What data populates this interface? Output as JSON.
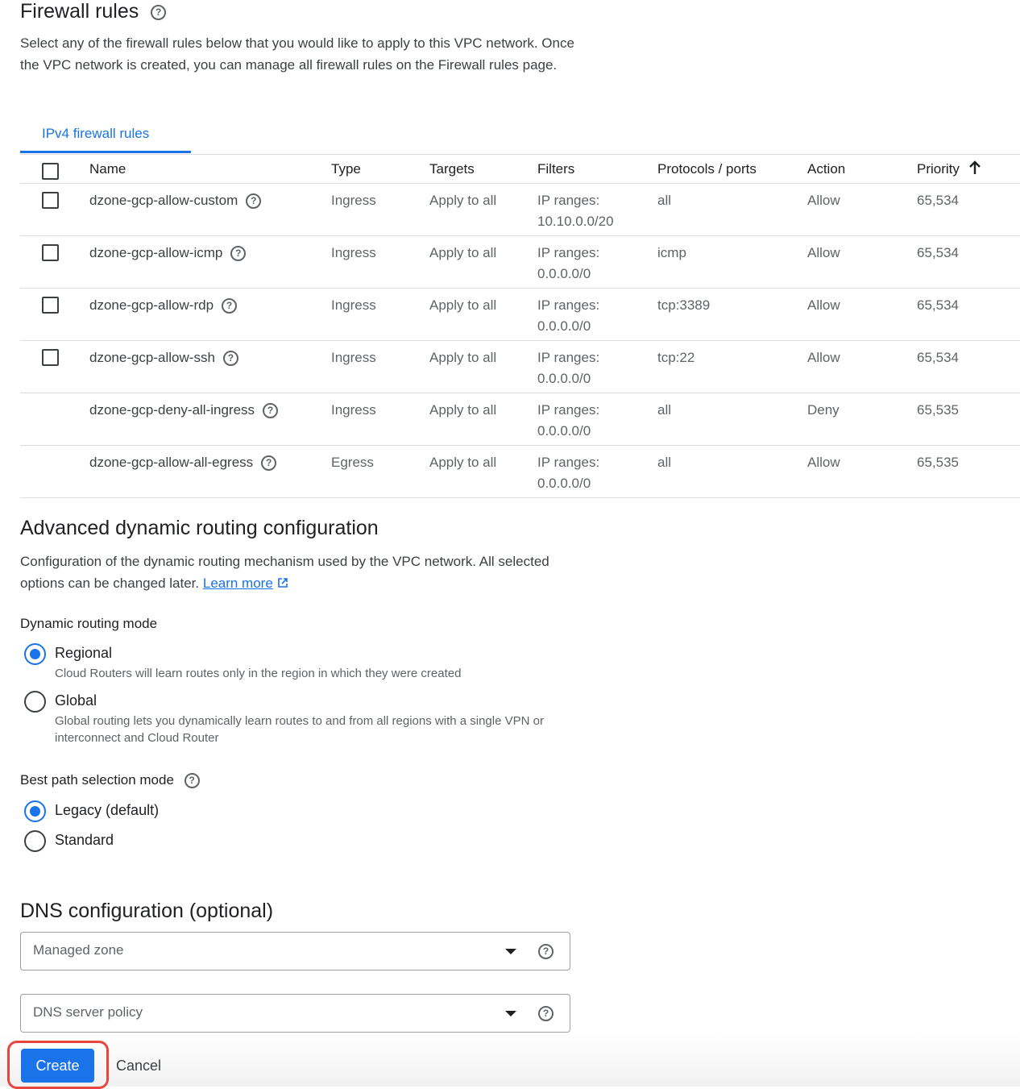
{
  "firewall": {
    "title": "Firewall rules",
    "description": "Select any of the firewall rules below that you would like to apply to this VPC network. Once the VPC network is created, you can manage all firewall rules on the Firewall rules page.",
    "tab_label": "IPv4 firewall rules",
    "columns": {
      "name": "Name",
      "type": "Type",
      "targets": "Targets",
      "filters": "Filters",
      "protocols": "Protocols / ports",
      "action": "Action",
      "priority": "Priority"
    },
    "sort_icon": "arrow-up-icon",
    "rows": [
      {
        "name": "dzone-gcp-allow-custom",
        "type": "Ingress",
        "targets": "Apply to all",
        "filters_line1": "IP ranges:",
        "filters_line2": "10.10.0.0/20",
        "protocols": "all",
        "action": "Allow",
        "priority": "65,534",
        "checkbox": true
      },
      {
        "name": "dzone-gcp-allow-icmp",
        "type": "Ingress",
        "targets": "Apply to all",
        "filters_line1": "IP ranges:",
        "filters_line2": "0.0.0.0/0",
        "protocols": "icmp",
        "action": "Allow",
        "priority": "65,534",
        "checkbox": true
      },
      {
        "name": "dzone-gcp-allow-rdp",
        "type": "Ingress",
        "targets": "Apply to all",
        "filters_line1": "IP ranges:",
        "filters_line2": "0.0.0.0/0",
        "protocols": "tcp:3389",
        "action": "Allow",
        "priority": "65,534",
        "checkbox": true
      },
      {
        "name": "dzone-gcp-allow-ssh",
        "type": "Ingress",
        "targets": "Apply to all",
        "filters_line1": "IP ranges:",
        "filters_line2": "0.0.0.0/0",
        "protocols": "tcp:22",
        "action": "Allow",
        "priority": "65,534",
        "checkbox": true
      },
      {
        "name": "dzone-gcp-deny-all-ingress",
        "type": "Ingress",
        "targets": "Apply to all",
        "filters_line1": "IP ranges:",
        "filters_line2": "0.0.0.0/0",
        "protocols": "all",
        "action": "Deny",
        "priority": "65,535",
        "checkbox": false
      },
      {
        "name": "dzone-gcp-allow-all-egress",
        "type": "Egress",
        "targets": "Apply to all",
        "filters_line1": "IP ranges:",
        "filters_line2": "0.0.0.0/0",
        "protocols": "all",
        "action": "Allow",
        "priority": "65,535",
        "checkbox": false
      }
    ]
  },
  "routing": {
    "title": "Advanced dynamic routing configuration",
    "description": "Configuration of the dynamic routing mechanism used by the VPC network. All selected options can be changed later.",
    "learn_more": "Learn more",
    "mode_label": "Dynamic routing mode",
    "modes": [
      {
        "label": "Regional",
        "desc": "Cloud Routers will learn routes only in the region in which they were created",
        "selected": true
      },
      {
        "label": "Global",
        "desc": "Global routing lets you dynamically learn routes to and from all regions with a single VPN or interconnect and Cloud Router",
        "selected": false
      }
    ],
    "best_path_label": "Best path selection mode",
    "best_path": [
      {
        "label": "Legacy (default)",
        "selected": true
      },
      {
        "label": "Standard",
        "selected": false
      }
    ]
  },
  "dns": {
    "title": "DNS configuration (optional)",
    "managed_zone_placeholder": "Managed zone",
    "server_policy_placeholder": "DNS server policy"
  },
  "footer": {
    "create_label": "Create",
    "cancel_label": "Cancel"
  },
  "colors": {
    "accent": "#1a73e8",
    "highlight": "#e8453c"
  }
}
